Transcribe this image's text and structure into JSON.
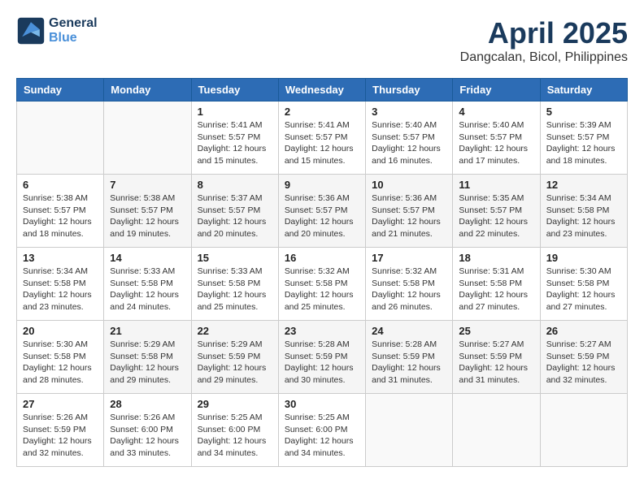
{
  "header": {
    "logo_line1": "General",
    "logo_line2": "Blue",
    "title": "April 2025",
    "subtitle": "Dangcalan, Bicol, Philippines"
  },
  "columns": [
    "Sunday",
    "Monday",
    "Tuesday",
    "Wednesday",
    "Thursday",
    "Friday",
    "Saturday"
  ],
  "weeks": [
    [
      {
        "day": "",
        "info": ""
      },
      {
        "day": "",
        "info": ""
      },
      {
        "day": "1",
        "info": "Sunrise: 5:41 AM\nSunset: 5:57 PM\nDaylight: 12 hours and 15 minutes."
      },
      {
        "day": "2",
        "info": "Sunrise: 5:41 AM\nSunset: 5:57 PM\nDaylight: 12 hours and 15 minutes."
      },
      {
        "day": "3",
        "info": "Sunrise: 5:40 AM\nSunset: 5:57 PM\nDaylight: 12 hours and 16 minutes."
      },
      {
        "day": "4",
        "info": "Sunrise: 5:40 AM\nSunset: 5:57 PM\nDaylight: 12 hours and 17 minutes."
      },
      {
        "day": "5",
        "info": "Sunrise: 5:39 AM\nSunset: 5:57 PM\nDaylight: 12 hours and 18 minutes."
      }
    ],
    [
      {
        "day": "6",
        "info": "Sunrise: 5:38 AM\nSunset: 5:57 PM\nDaylight: 12 hours and 18 minutes."
      },
      {
        "day": "7",
        "info": "Sunrise: 5:38 AM\nSunset: 5:57 PM\nDaylight: 12 hours and 19 minutes."
      },
      {
        "day": "8",
        "info": "Sunrise: 5:37 AM\nSunset: 5:57 PM\nDaylight: 12 hours and 20 minutes."
      },
      {
        "day": "9",
        "info": "Sunrise: 5:36 AM\nSunset: 5:57 PM\nDaylight: 12 hours and 20 minutes."
      },
      {
        "day": "10",
        "info": "Sunrise: 5:36 AM\nSunset: 5:57 PM\nDaylight: 12 hours and 21 minutes."
      },
      {
        "day": "11",
        "info": "Sunrise: 5:35 AM\nSunset: 5:57 PM\nDaylight: 12 hours and 22 minutes."
      },
      {
        "day": "12",
        "info": "Sunrise: 5:34 AM\nSunset: 5:58 PM\nDaylight: 12 hours and 23 minutes."
      }
    ],
    [
      {
        "day": "13",
        "info": "Sunrise: 5:34 AM\nSunset: 5:58 PM\nDaylight: 12 hours and 23 minutes."
      },
      {
        "day": "14",
        "info": "Sunrise: 5:33 AM\nSunset: 5:58 PM\nDaylight: 12 hours and 24 minutes."
      },
      {
        "day": "15",
        "info": "Sunrise: 5:33 AM\nSunset: 5:58 PM\nDaylight: 12 hours and 25 minutes."
      },
      {
        "day": "16",
        "info": "Sunrise: 5:32 AM\nSunset: 5:58 PM\nDaylight: 12 hours and 25 minutes."
      },
      {
        "day": "17",
        "info": "Sunrise: 5:32 AM\nSunset: 5:58 PM\nDaylight: 12 hours and 26 minutes."
      },
      {
        "day": "18",
        "info": "Sunrise: 5:31 AM\nSunset: 5:58 PM\nDaylight: 12 hours and 27 minutes."
      },
      {
        "day": "19",
        "info": "Sunrise: 5:30 AM\nSunset: 5:58 PM\nDaylight: 12 hours and 27 minutes."
      }
    ],
    [
      {
        "day": "20",
        "info": "Sunrise: 5:30 AM\nSunset: 5:58 PM\nDaylight: 12 hours and 28 minutes."
      },
      {
        "day": "21",
        "info": "Sunrise: 5:29 AM\nSunset: 5:58 PM\nDaylight: 12 hours and 29 minutes."
      },
      {
        "day": "22",
        "info": "Sunrise: 5:29 AM\nSunset: 5:59 PM\nDaylight: 12 hours and 29 minutes."
      },
      {
        "day": "23",
        "info": "Sunrise: 5:28 AM\nSunset: 5:59 PM\nDaylight: 12 hours and 30 minutes."
      },
      {
        "day": "24",
        "info": "Sunrise: 5:28 AM\nSunset: 5:59 PM\nDaylight: 12 hours and 31 minutes."
      },
      {
        "day": "25",
        "info": "Sunrise: 5:27 AM\nSunset: 5:59 PM\nDaylight: 12 hours and 31 minutes."
      },
      {
        "day": "26",
        "info": "Sunrise: 5:27 AM\nSunset: 5:59 PM\nDaylight: 12 hours and 32 minutes."
      }
    ],
    [
      {
        "day": "27",
        "info": "Sunrise: 5:26 AM\nSunset: 5:59 PM\nDaylight: 12 hours and 32 minutes."
      },
      {
        "day": "28",
        "info": "Sunrise: 5:26 AM\nSunset: 6:00 PM\nDaylight: 12 hours and 33 minutes."
      },
      {
        "day": "29",
        "info": "Sunrise: 5:25 AM\nSunset: 6:00 PM\nDaylight: 12 hours and 34 minutes."
      },
      {
        "day": "30",
        "info": "Sunrise: 5:25 AM\nSunset: 6:00 PM\nDaylight: 12 hours and 34 minutes."
      },
      {
        "day": "",
        "info": ""
      },
      {
        "day": "",
        "info": ""
      },
      {
        "day": "",
        "info": ""
      }
    ]
  ]
}
